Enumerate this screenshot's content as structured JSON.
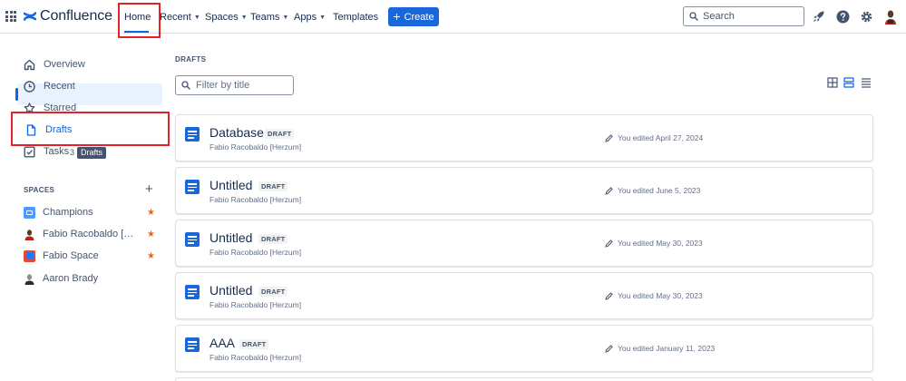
{
  "topnav": {
    "logo_text": "Confluence",
    "items": [
      {
        "label": "Home"
      },
      {
        "label": "Recent"
      },
      {
        "label": "Spaces"
      },
      {
        "label": "Teams"
      },
      {
        "label": "Apps"
      },
      {
        "label": "Templates"
      }
    ],
    "create_label": "Create",
    "search_placeholder": "Search"
  },
  "sidebar": {
    "items": [
      {
        "label": "Overview",
        "icon": "home-icon"
      },
      {
        "label": "Recent",
        "icon": "clock-icon"
      },
      {
        "label": "Starred",
        "icon": "star-icon"
      },
      {
        "label": "Drafts",
        "icon": "document-icon"
      },
      {
        "label": "Tasks",
        "icon": "checkbox-icon"
      }
    ],
    "task_count": "3",
    "tooltip": "Drafts",
    "spaces_label": "SPACES",
    "spaces": [
      {
        "label": "Champions",
        "starred": "★"
      },
      {
        "label": "Fabio Racobaldo [Herzum]",
        "starred": "★"
      },
      {
        "label": "Fabio Space",
        "starred": "★"
      },
      {
        "label": "Aaron Brady",
        "starred": ""
      }
    ]
  },
  "main": {
    "heading": "DRAFTS",
    "filter_placeholder": "Filter by title",
    "drafts": [
      {
        "title": "Database",
        "badge": "DRAFT",
        "author": "Fabio Racobaldo [Herzum]",
        "edited": "You edited April 27, 2024"
      },
      {
        "title": "Untitled",
        "badge": "DRAFT",
        "author": "Fabio Racobaldo [Herzum]",
        "edited": "You edited June 5, 2023"
      },
      {
        "title": "Untitled",
        "badge": "DRAFT",
        "author": "Fabio Racobaldo [Herzum]",
        "edited": "You edited May 30, 2023"
      },
      {
        "title": "Untitled",
        "badge": "DRAFT",
        "author": "Fabio Racobaldo [Herzum]",
        "edited": "You edited May 30, 2023"
      },
      {
        "title": "AAA",
        "badge": "DRAFT",
        "author": "Fabio Racobaldo [Herzum]",
        "edited": "You edited January 11, 2023"
      }
    ]
  },
  "colors": {
    "accent": "#1868db",
    "highlight_box": "#e2232a",
    "star": "#e56910",
    "active_bg": "#e9f2ff"
  }
}
